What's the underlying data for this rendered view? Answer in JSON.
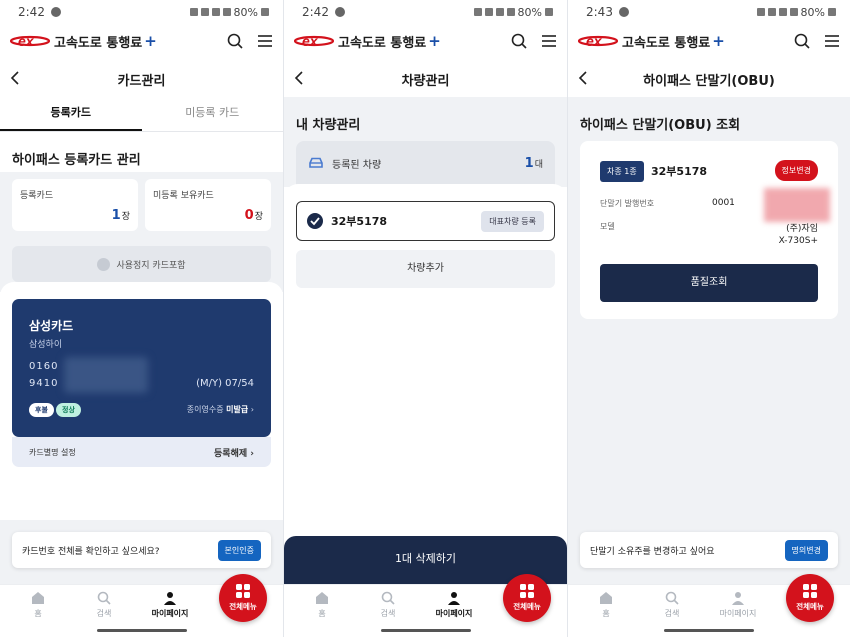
{
  "colors": {
    "navy": "#1b2a4a",
    "brand_red": "#d3121c",
    "brand_blue": "#1a4fa8",
    "card_blue": "#1f3a6e"
  },
  "app": {
    "brand": "고속도로 통행료",
    "brand_plus": "+"
  },
  "screens": [
    {
      "status_time": "2:42",
      "status_battery": "80%",
      "title": "카드관리",
      "tabs": [
        "등록카드",
        "미등록 카드"
      ],
      "section_title": "하이패스 등록카드 관리",
      "registered_label": "등록카드",
      "registered_count": "1",
      "unit": "장",
      "unregistered_label": "미등록 보유카드",
      "unregistered_count": "0",
      "include_suspended": "사용정지 카드포함",
      "card": {
        "name": "삼성카드",
        "sub": "삼성하이",
        "number_line1": "0160",
        "number_line2": "9410",
        "expiry": "(M/Y) 07/54",
        "chip_postpaid": "후불",
        "chip_status": "정상",
        "receipt_label": "종이영수증",
        "receipt_value": "미발급",
        "alias_label": "카드별명 설정",
        "unregister": "등록해제"
      },
      "notice_text": "카드번호 전체를 확인하고 싶으세요?",
      "notice_button": "본인인증"
    },
    {
      "status_time": "2:42",
      "status_battery": "80%",
      "title": "차량관리",
      "section_title": "내 차량관리",
      "registered_vehicles_label": "등록된 차량",
      "registered_vehicles_count": "1",
      "vehicle_unit": "대",
      "vehicle_plate": "32부5178",
      "rep_button": "대표차량 등록",
      "add_vehicle": "차량추가",
      "delete_button": "1대 삭제하기"
    },
    {
      "status_time": "2:43",
      "status_battery": "80%",
      "title": "하이패스 단말기(OBU)",
      "section_title": "하이패스 단말기(OBU) 조회",
      "vehicle_type": "차종 1종",
      "plate": "32부5178",
      "info_change": "정보변경",
      "serial_label": "단말기 발행번호",
      "serial_value": "0001",
      "model_label": "모델",
      "model_maker": "(주)자임",
      "model_name": "X-730S+",
      "quality_button": "품질조회",
      "notice_text": "단말기 소유주를 변경하고 싶어요",
      "notice_button": "명의변경"
    }
  ],
  "nav": {
    "home": "홈",
    "search": "검색",
    "mypage": "마이페이지",
    "all_menu": "전체메뉴"
  }
}
